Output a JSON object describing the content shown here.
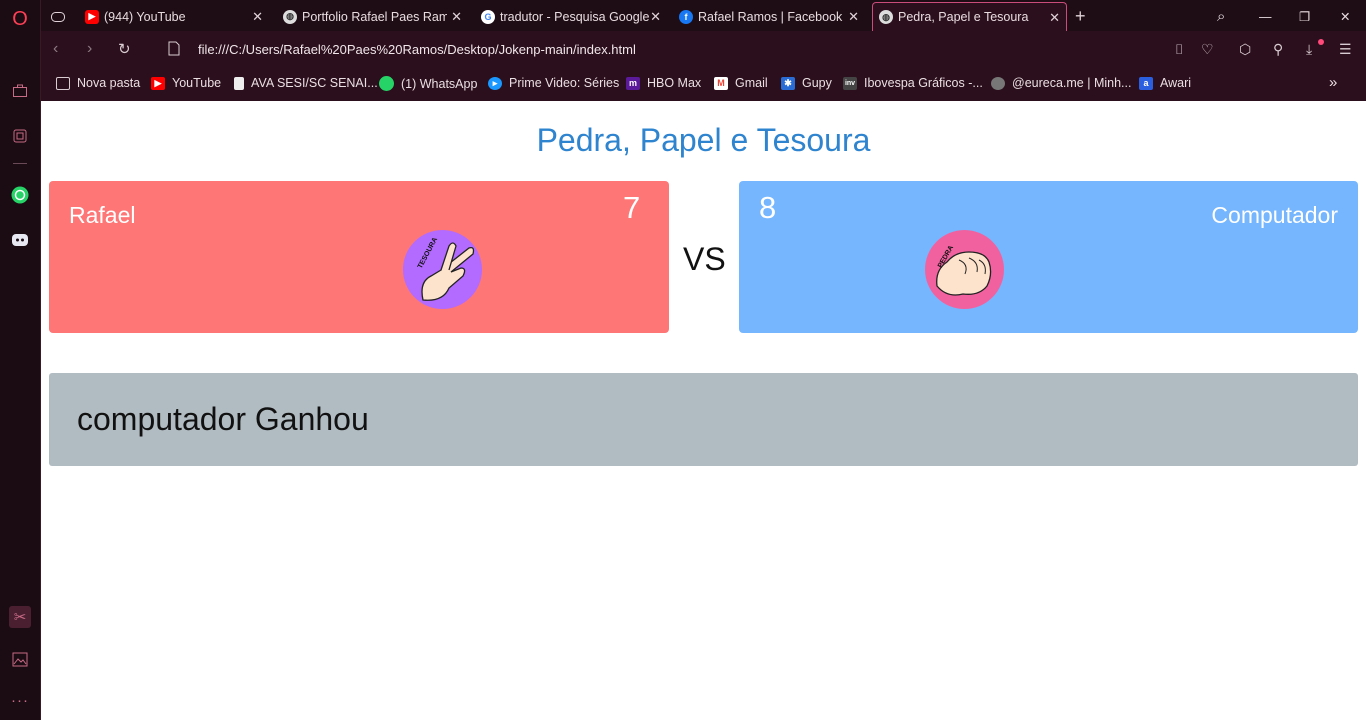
{
  "browser": {
    "tabs": [
      {
        "label": "(944) YouTube",
        "icon": "youtube-icon"
      },
      {
        "label": "Portfolio Rafael Paes Ramos",
        "icon": "globe-icon"
      },
      {
        "label": "tradutor - Pesquisa Google",
        "icon": "google-icon"
      },
      {
        "label": "Rafael Ramos | Facebook",
        "icon": "facebook-icon"
      },
      {
        "label": "Pedra, Papel e Tesoura",
        "icon": "globe-icon"
      }
    ],
    "url": "file:///C:/Users/Rafael%20Paes%20Ramos/Desktop/Jokenp-main/index.html",
    "bookmarks": [
      {
        "label": "Nova pasta"
      },
      {
        "label": "YouTube"
      },
      {
        "label": "AVA SESI/SC SENAI..."
      },
      {
        "label": "(1) WhatsApp"
      },
      {
        "label": "Prime Video: Séries"
      },
      {
        "label": "HBO Max"
      },
      {
        "label": "Gmail"
      },
      {
        "label": "Gupy"
      },
      {
        "label": "Ibovespa Gráficos -..."
      },
      {
        "label": "@eureca.me | Minh..."
      },
      {
        "label": "Awari"
      }
    ]
  },
  "game": {
    "title": "Pedra, Papel e Tesoura",
    "player": {
      "name": "Rafael",
      "score": "7",
      "choice_label": "TESOURA",
      "color": "#fe7676"
    },
    "computer": {
      "name": "Computador",
      "score": "8",
      "choice_label": "PEDRA",
      "color": "#76b6fe"
    },
    "vs": "VS",
    "result": "computador Ganhou"
  },
  "colors": {
    "title": "#2e84cf",
    "result_bg": "#b1bcc2",
    "browser_accent": "#c94c7a"
  }
}
